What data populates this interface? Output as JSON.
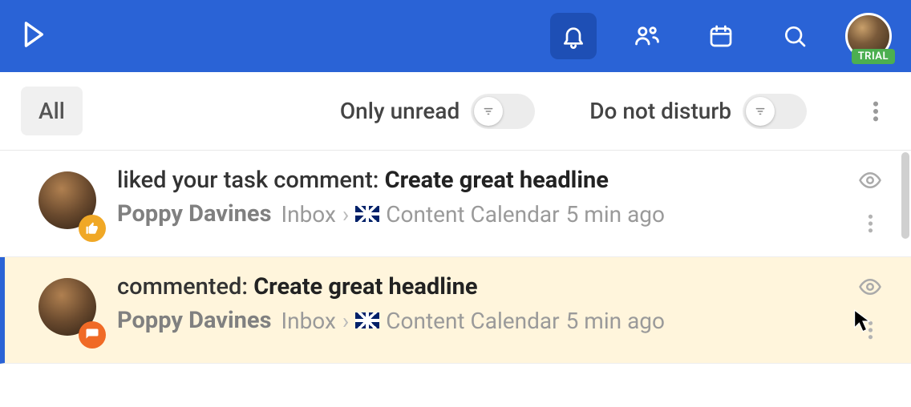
{
  "topbar": {
    "trial_badge": "TRIAL"
  },
  "filterbar": {
    "all_label": "All",
    "unread_label": "Only unread",
    "dnd_label": "Do not disturb"
  },
  "notifications": [
    {
      "action_prefix": "liked your task comment: ",
      "action_object": "Create great headline",
      "user": "Poppy Davines",
      "folder": "Inbox",
      "project": "Content Calendar",
      "time": "5 min ago",
      "badge": "like",
      "selected": false
    },
    {
      "action_prefix": "commented: ",
      "action_object": "Create great headline",
      "user": "Poppy Davines",
      "folder": "Inbox",
      "project": "Content Calendar",
      "time": "5 min ago",
      "badge": "comment",
      "selected": true
    }
  ]
}
